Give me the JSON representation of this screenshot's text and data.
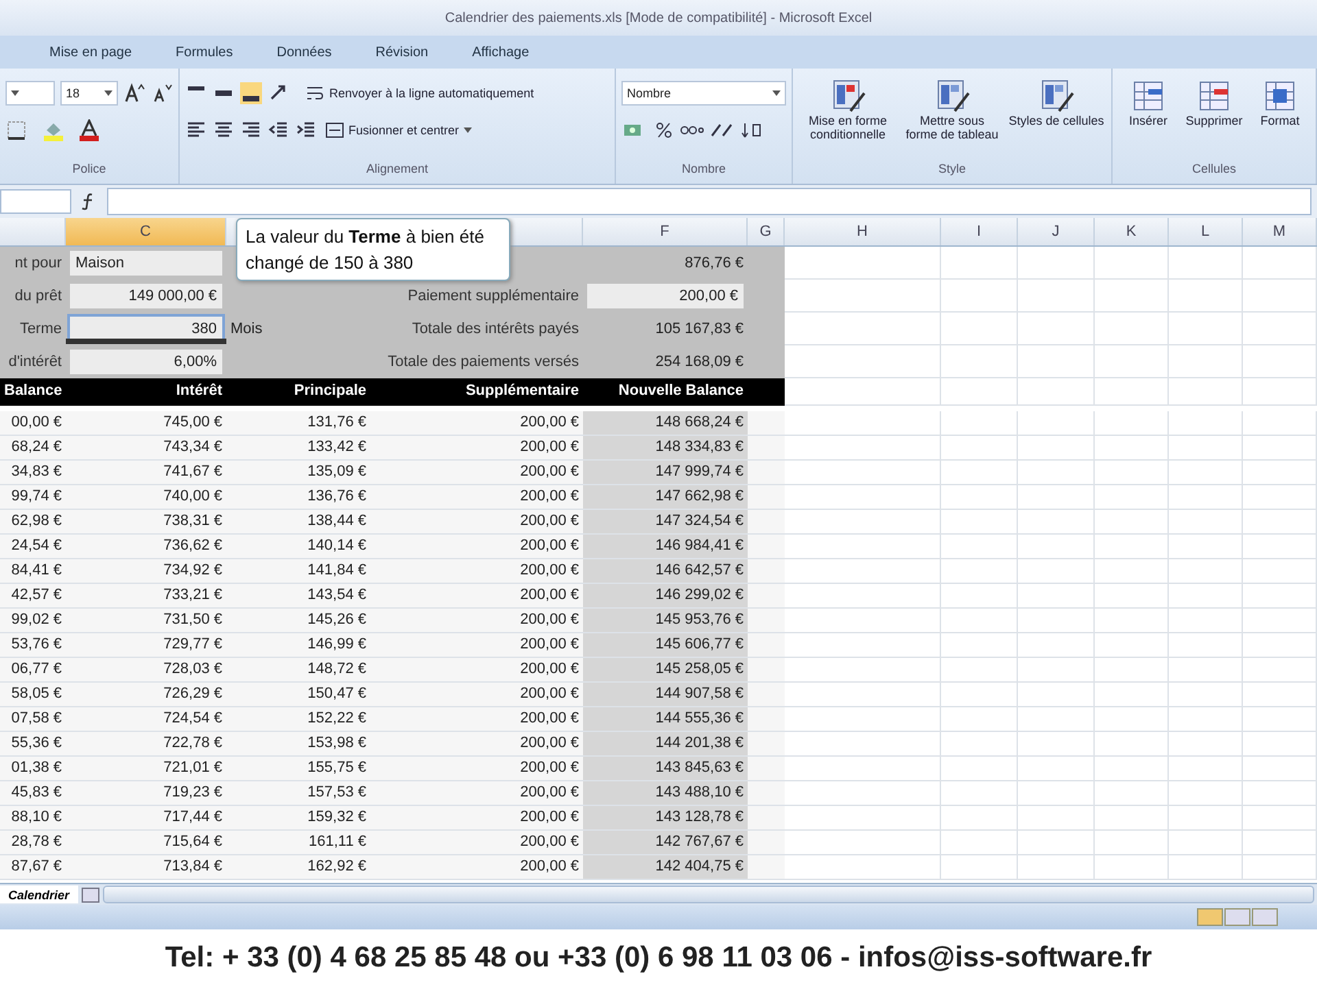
{
  "window": {
    "title": "Calendrier des paiements.xls [Mode de compatibilité] - Microsoft Excel"
  },
  "ribbon_tabs": [
    {
      "label": "Mise en page",
      "selected": false
    },
    {
      "label": "Formules",
      "selected": false
    },
    {
      "label": "Données",
      "selected": false
    },
    {
      "label": "Révision",
      "selected": false
    },
    {
      "label": "Affichage",
      "selected": false
    }
  ],
  "ribbon": {
    "font_size": "18",
    "wrap_button": "Renvoyer à la ligne automatiquement",
    "merge_button": "Fusionner et centrer",
    "number_format": "Nombre",
    "style_buttons": [
      "Mise en forme conditionnelle",
      "Mettre sous forme de tableau",
      "Styles de cellules"
    ],
    "cell_buttons": [
      "Insérer",
      "Supprimer",
      "Format"
    ],
    "groups": [
      "Police",
      "Alignement",
      "Nombre",
      "Style",
      "Cellules"
    ]
  },
  "columns": [
    {
      "label": "C",
      "selected": true
    },
    {
      "label": "F",
      "selected": false
    },
    {
      "label": "G",
      "selected": false
    },
    {
      "label": "H",
      "selected": false
    },
    {
      "label": "I",
      "selected": false
    },
    {
      "label": "J",
      "selected": false
    },
    {
      "label": "K",
      "selected": false
    },
    {
      "label": "L",
      "selected": false
    },
    {
      "label": "M",
      "selected": false
    }
  ],
  "summary": [
    {
      "label": "nt pour",
      "value": "Maison",
      "kind": "text",
      "right_value": "876,76 €"
    },
    {
      "label": "du prêt",
      "value": "149 000,00 €",
      "kind": "number",
      "right_label": "Paiement supplémentaire",
      "right_value": "200,00 €"
    },
    {
      "label": "Terme",
      "value": "380",
      "kind": "slider",
      "unit": "Mois",
      "right_label": "Totale des intérêts payés",
      "right_value": "105 167,83 €"
    },
    {
      "label": "d'intérêt",
      "value": "6,00%",
      "kind": "number",
      "right_label": "Totale des paiements versés",
      "right_value": "254 168,09 €"
    }
  ],
  "tooltip": "La valeur du **Terme** à bien été changé de 150 à 380",
  "table": {
    "columns": [
      "Balance",
      "Intérêt",
      "Principale",
      "Supplémentaire",
      "Nouvelle Balance"
    ],
    "rows": [
      [
        "00,00 €",
        "745,00 €",
        "131,76 €",
        "200,00 €",
        "148 668,24 €"
      ],
      [
        "68,24 €",
        "743,34 €",
        "133,42 €",
        "200,00 €",
        "148 334,83 €"
      ],
      [
        "34,83 €",
        "741,67 €",
        "135,09 €",
        "200,00 €",
        "147 999,74 €"
      ],
      [
        "99,74 €",
        "740,00 €",
        "136,76 €",
        "200,00 €",
        "147 662,98 €"
      ],
      [
        "62,98 €",
        "738,31 €",
        "138,44 €",
        "200,00 €",
        "147 324,54 €"
      ],
      [
        "24,54 €",
        "736,62 €",
        "140,14 €",
        "200,00 €",
        "146 984,41 €"
      ],
      [
        "84,41 €",
        "734,92 €",
        "141,84 €",
        "200,00 €",
        "146 642,57 €"
      ],
      [
        "42,57 €",
        "733,21 €",
        "143,54 €",
        "200,00 €",
        "146 299,02 €"
      ],
      [
        "99,02 €",
        "731,50 €",
        "145,26 €",
        "200,00 €",
        "145 953,76 €"
      ],
      [
        "53,76 €",
        "729,77 €",
        "146,99 €",
        "200,00 €",
        "145 606,77 €"
      ],
      [
        "06,77 €",
        "728,03 €",
        "148,72 €",
        "200,00 €",
        "145 258,05 €"
      ],
      [
        "58,05 €",
        "726,29 €",
        "150,47 €",
        "200,00 €",
        "144 907,58 €"
      ],
      [
        "07,58 €",
        "724,54 €",
        "152,22 €",
        "200,00 €",
        "144 555,36 €"
      ],
      [
        "55,36 €",
        "722,78 €",
        "153,98 €",
        "200,00 €",
        "144 201,38 €"
      ],
      [
        "01,38 €",
        "721,01 €",
        "155,75 €",
        "200,00 €",
        "143 845,63 €"
      ],
      [
        "45,83 €",
        "719,23 €",
        "157,53 €",
        "200,00 €",
        "143 488,10 €"
      ],
      [
        "88,10 €",
        "717,44 €",
        "159,32 €",
        "200,00 €",
        "143 128,78 €"
      ],
      [
        "28,78 €",
        "715,64 €",
        "161,11 €",
        "200,00 €",
        "142 767,67 €"
      ],
      [
        "87,67 €",
        "713,84 €",
        "162,92 €",
        "200,00 €",
        "142 404,75 €"
      ]
    ]
  },
  "sheet_tab": "Calendrier",
  "footer": "Tel: + 33 (0) 4 68 25 85 48 ou +33 (0) 6 98 11 03 06 - infos@iss-software.fr"
}
